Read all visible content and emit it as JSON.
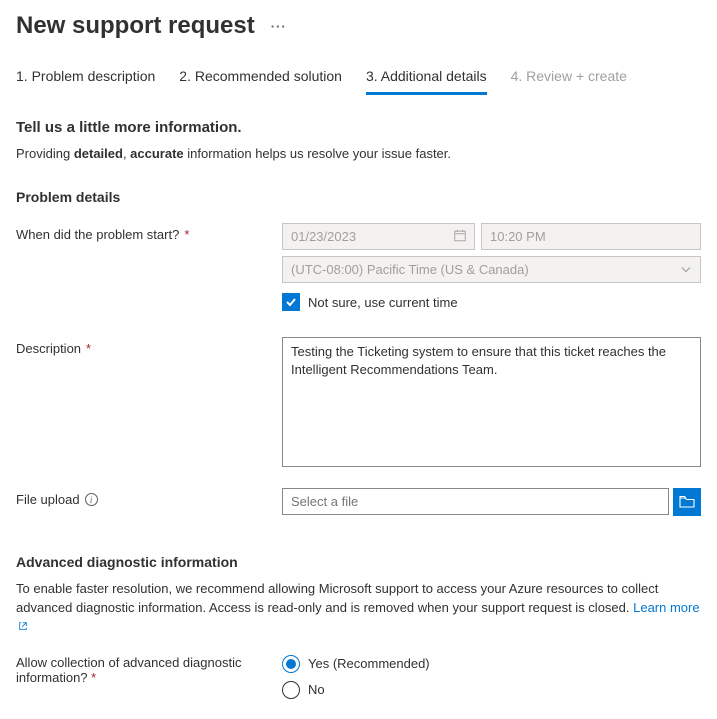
{
  "header": {
    "title": "New support request"
  },
  "tabs": [
    {
      "label": "1. Problem description",
      "state": "enabled"
    },
    {
      "label": "2. Recommended solution",
      "state": "enabled"
    },
    {
      "label": "3. Additional details",
      "state": "active"
    },
    {
      "label": "4. Review + create",
      "state": "disabled"
    }
  ],
  "intro": {
    "heading": "Tell us a little more information.",
    "text_before": "Providing ",
    "bold1": "detailed",
    "comma": ", ",
    "bold2": "accurate",
    "text_after": " information helps us resolve your issue faster."
  },
  "problem": {
    "heading": "Problem details",
    "start_label": "When did the problem start?",
    "date_value": "01/23/2023",
    "time_value": "10:20 PM",
    "timezone_value": "(UTC-08:00) Pacific Time (US & Canada)",
    "not_sure_label": "Not sure, use current time",
    "not_sure_checked": true,
    "description_label": "Description",
    "description_value": "Testing the Ticketing system to ensure that this ticket reaches the Intelligent Recommendations Team.",
    "file_label": "File upload",
    "file_placeholder": "Select a file"
  },
  "advanced": {
    "heading": "Advanced diagnostic information",
    "body": "To enable faster resolution, we recommend allowing Microsoft support to access your Azure resources to collect advanced diagnostic information. Access is read-only and is removed when your support request is closed. ",
    "learn_more": "Learn more",
    "allow_label_line1": "Allow collection of advanced diagnostic",
    "allow_label_line2": "information?",
    "options": {
      "yes": "Yes (Recommended)",
      "no": "No"
    },
    "selected": "yes"
  }
}
